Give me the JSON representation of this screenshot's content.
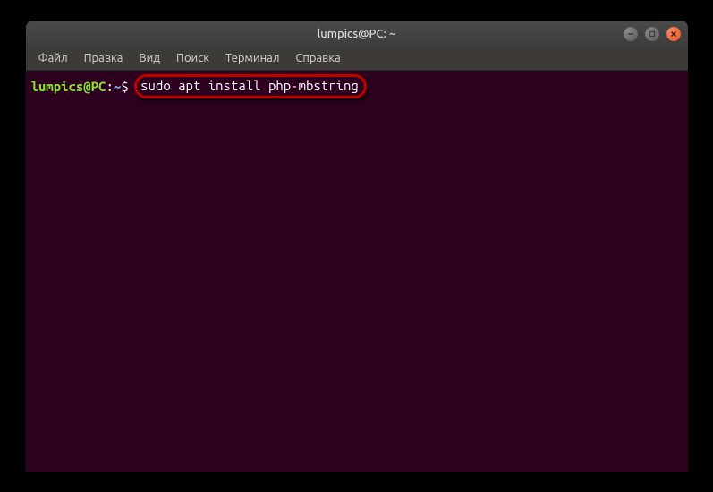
{
  "titlebar": {
    "title": "lumpics@PC: ~"
  },
  "menubar": {
    "items": [
      {
        "label": "Файл"
      },
      {
        "label": "Правка"
      },
      {
        "label": "Вид"
      },
      {
        "label": "Поиск"
      },
      {
        "label": "Терминал"
      },
      {
        "label": "Справка"
      }
    ]
  },
  "terminal": {
    "prompt_user": "lumpics@PC",
    "prompt_sep": ":",
    "prompt_path": "~",
    "prompt_dollar": "$ ",
    "command": "sudo apt install php-mbstring"
  }
}
